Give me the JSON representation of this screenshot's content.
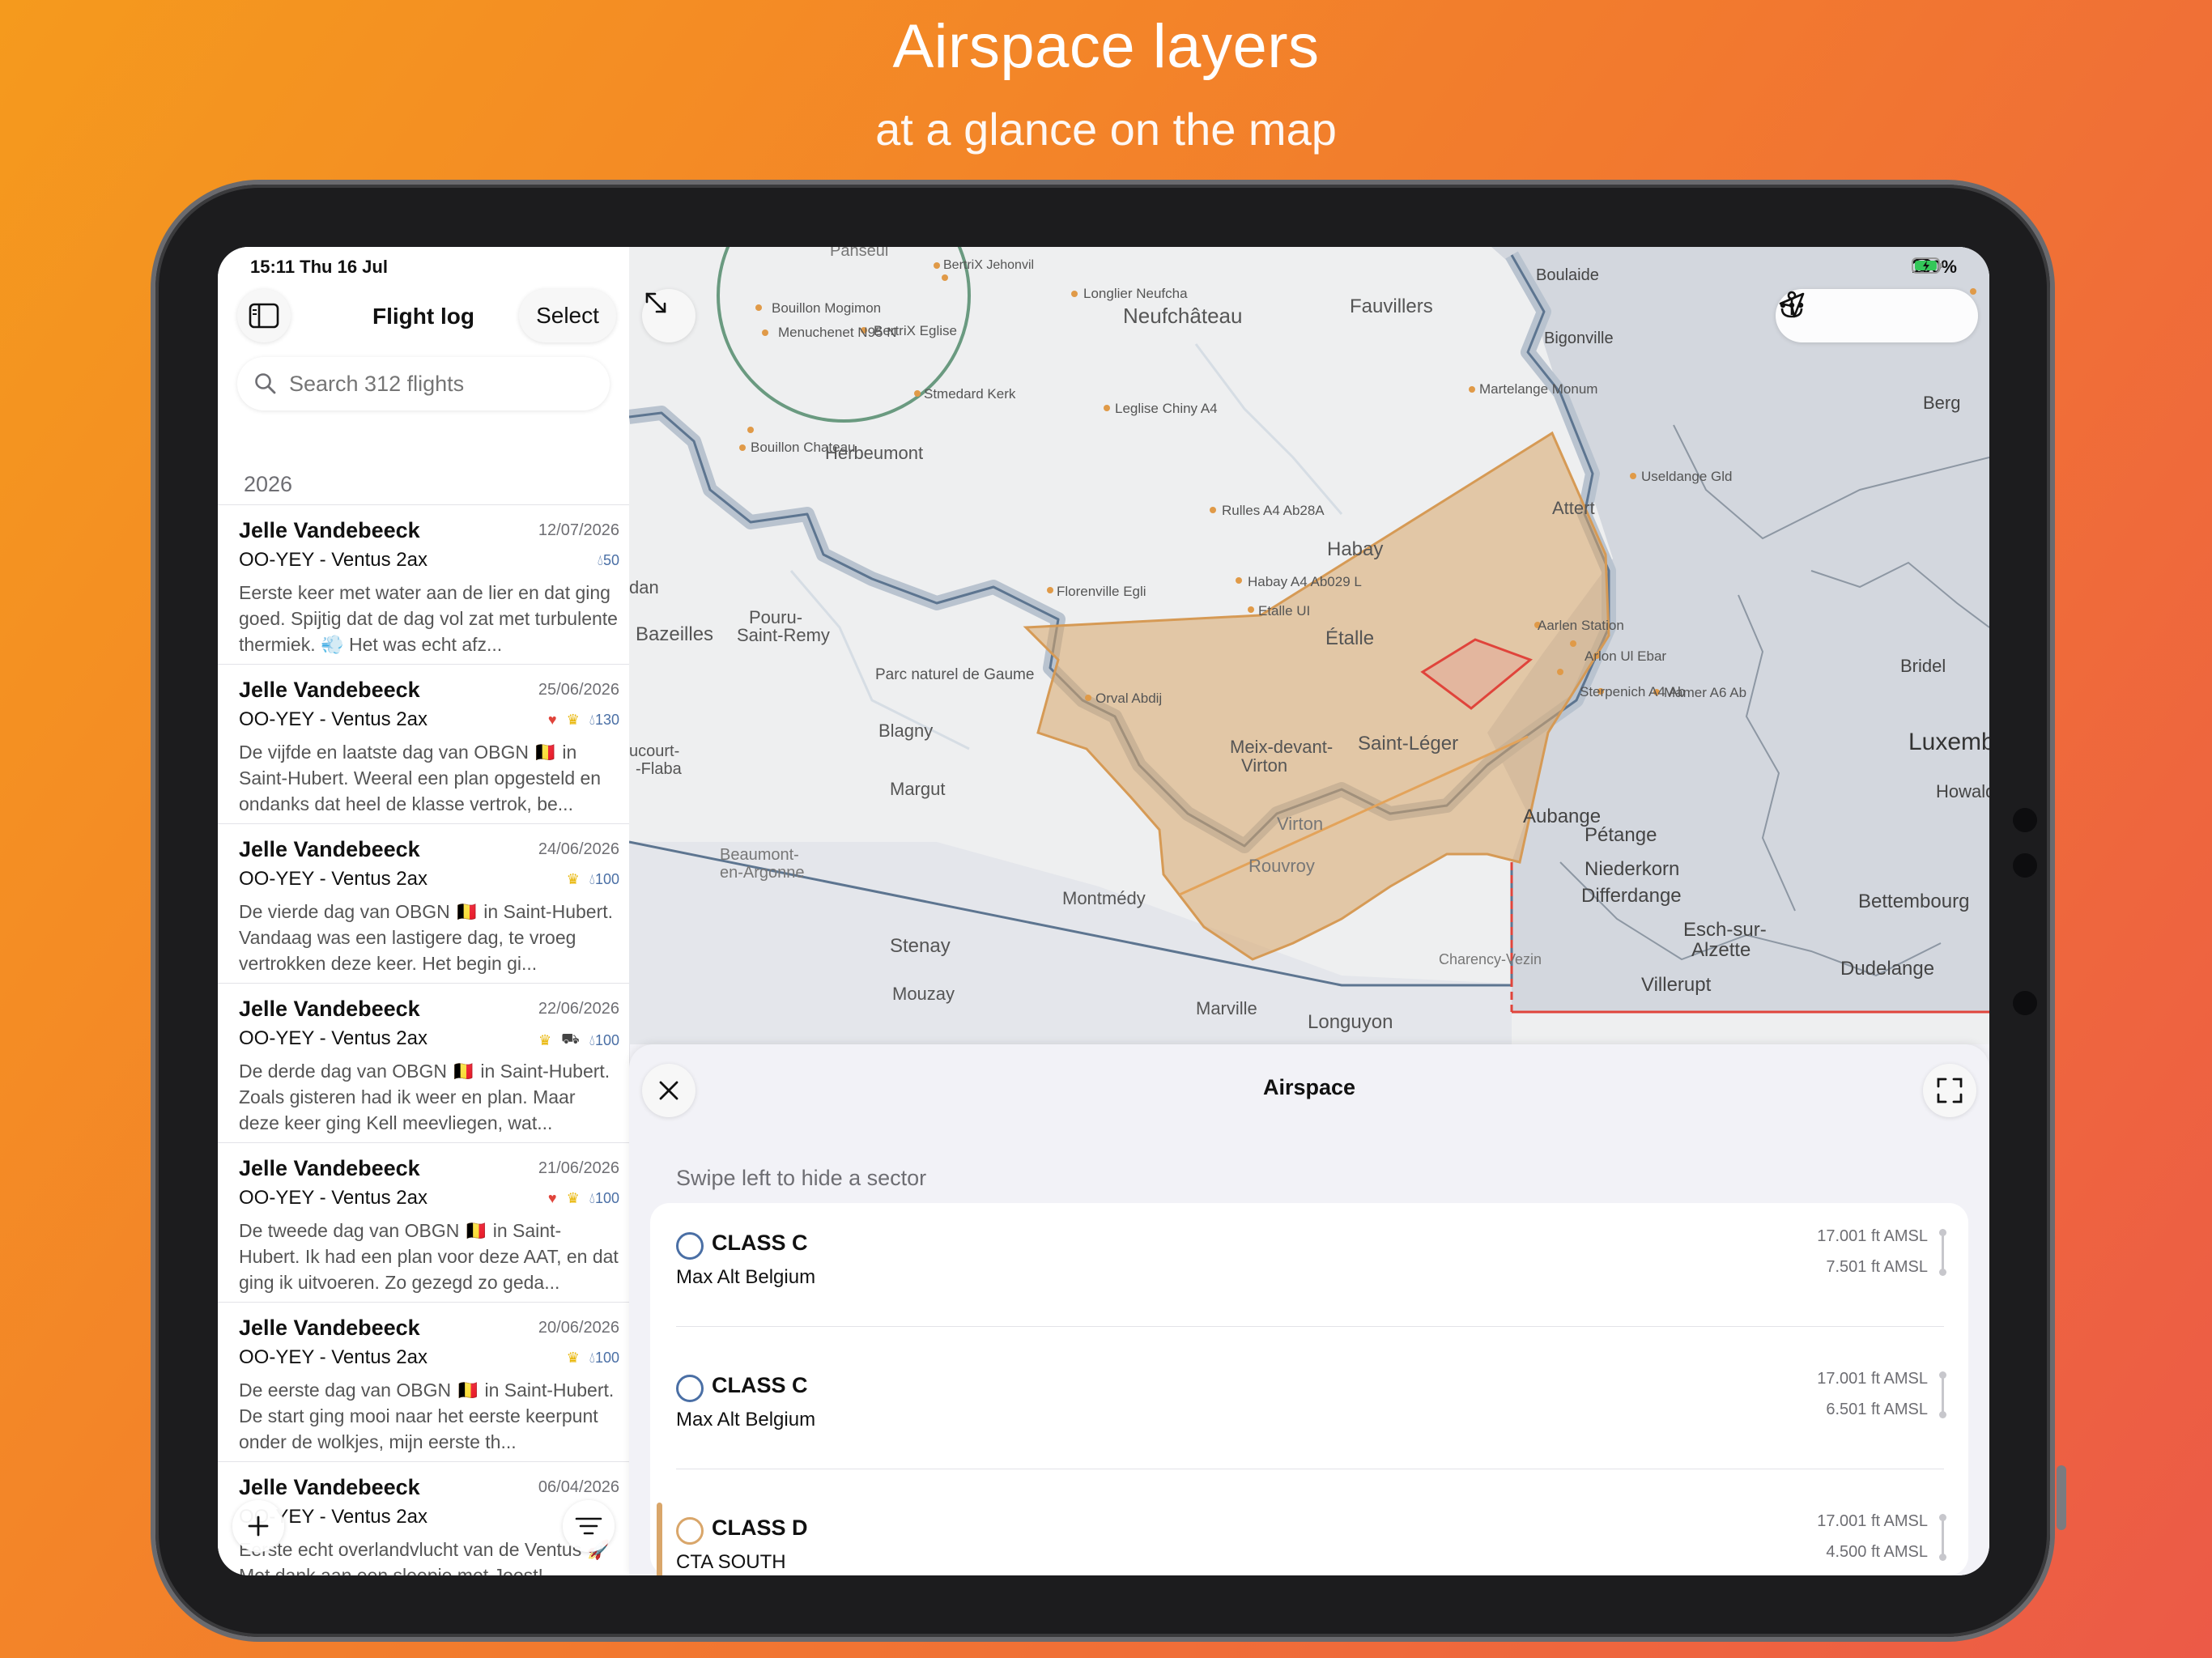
{
  "hero": {
    "title": "Airspace layers",
    "subtitle": "at a glance on the map"
  },
  "status": {
    "time_date": "15:11  Thu 16 Jul",
    "battery": "100%"
  },
  "sidebar": {
    "title": "Flight log",
    "select_label": "Select",
    "search_placeholder": "Search 312 flights",
    "year": "2026",
    "entries": [
      {
        "name": "Jelle Vandebeeck",
        "date": "12/07/2026",
        "plane": "OO-YEY - Ventus 2ax",
        "water": "50",
        "heart": false,
        "crown": false,
        "car": false,
        "preview": "Eerste keer met water aan de lier en dat ging goed. Spijtig dat de dag vol zat met turbulente thermiek. 💨 Het was echt afz..."
      },
      {
        "name": "Jelle Vandebeeck",
        "date": "25/06/2026",
        "plane": "OO-YEY - Ventus 2ax",
        "water": "130",
        "heart": true,
        "crown": true,
        "car": false,
        "preview": "De vijfde en laatste dag van OBGN 🇧🇪 in Saint-Hubert. Weeral een plan opgesteld en ondanks dat heel de klasse vertrok, be..."
      },
      {
        "name": "Jelle Vandebeeck",
        "date": "24/06/2026",
        "plane": "OO-YEY - Ventus 2ax",
        "water": "100",
        "heart": false,
        "crown": true,
        "car": false,
        "preview": "De vierde dag van OBGN 🇧🇪 in Saint-Hubert. Vandaag was een lastigere dag, te vroeg vertrokken deze keer. Het begin gi..."
      },
      {
        "name": "Jelle Vandebeeck",
        "date": "22/06/2026",
        "plane": "OO-YEY - Ventus 2ax",
        "water": "100",
        "heart": false,
        "crown": true,
        "car": true,
        "preview": "De derde dag van OBGN 🇧🇪 in Saint-Hubert. Zoals gisteren had ik weer en plan. Maar deze keer ging Kell meevliegen, wat..."
      },
      {
        "name": "Jelle Vandebeeck",
        "date": "21/06/2026",
        "plane": "OO-YEY - Ventus 2ax",
        "water": "100",
        "heart": true,
        "crown": true,
        "car": false,
        "preview": "De tweede dag van OBGN 🇧🇪 in Saint-Hubert. Ik had een plan voor deze AAT, en dat ging ik uitvoeren. Zo gezegd zo geda..."
      },
      {
        "name": "Jelle Vandebeeck",
        "date": "20/06/2026",
        "plane": "OO-YEY - Ventus 2ax",
        "water": "100",
        "heart": false,
        "crown": true,
        "car": false,
        "preview": "De eerste dag van OBGN 🇧🇪 in Saint-Hubert. De start ging mooi naar het eerste keerpunt onder de wolkjes, mijn eerste th..."
      },
      {
        "name": "Jelle Vandebeeck",
        "date": "06/04/2026",
        "plane": "OO-YEY - Ventus 2ax",
        "water": "",
        "heart": false,
        "crown": false,
        "car": false,
        "preview": "Eerste echt overlandvlucht van de Ventus 🚀 Met dank aan een sleepje met Joost!"
      }
    ]
  },
  "map": {
    "labels": {
      "neufchateau": "Neufchâteau",
      "fauvillers": "Fauvillers",
      "herbeumont": "Herbeumont",
      "habay": "Habay",
      "etalle": "Étalle",
      "attert": "Attert",
      "saint_leger": "Saint-Léger",
      "meix": "Meix-devant-",
      "virton_sub": "Virton",
      "virton": "Virton",
      "rouvroy": "Rouvroy",
      "blagny": "Blagny",
      "margut": "Margut",
      "montmedy": "Montmédy",
      "stenay": "Stenay",
      "mouzay": "Mouzay",
      "marville": "Marville",
      "longuyon": "Longuyon",
      "bazeilles": "Bazeilles",
      "pouru1": "Pouru-",
      "pouru2": "Saint-Remy",
      "ucourt1": "ucourt-",
      "ucourt2": "-Flaba",
      "dan": "dan",
      "aubange": "Aubange",
      "petange": "Pétange",
      "niederkorn": "Niederkorn",
      "differdange": "Differdange",
      "esch1": "Esch-sur-",
      "esch2": "Alzette",
      "dudelange": "Dudelange",
      "villerupt": "Villerupt",
      "bettembourg": "Bettembourg",
      "luxembourg": "Luxembourg",
      "howald": "Howald",
      "berg": "Berg",
      "bridel": "Bridel",
      "boulaide": "Boulaide",
      "bigonville": "Bigonville",
      "parc": "Parc naturel de Gaume",
      "beaumont1": "Beaumont-",
      "beaumont2": "en-Argonne",
      "charency": "Charency-Vezin",
      "pahseul": "Pahseul",
      "wp_bertrix_jehonvil": "BertriX Jehonvil",
      "wp_bouillon_mogimon": "Bouillon Mogimon",
      "wp_menuchenet": "Menuchenet N95 N",
      "wp_bertrix_eglise": "BertriX Eglise",
      "wp_longlier": "Longlier Neufcha",
      "wp_stmedard": "Stmedard Kerk",
      "wp_leglise": "Leglise Chiny A4",
      "wp_martelange": "Martelange Monum",
      "wp_bouillon_chateau": "Bouillon Chateau",
      "wp_rulles": "Rulles A4 Ab28A",
      "wp_habay": "Habay A4 Ab029 L",
      "wp_etalle": "Etalle UI",
      "wp_florenville": "Florenville Egli",
      "wp_orval": "Orval Abdij",
      "wp_arlon_station": "Aarlen Station",
      "wp_arlon_ebar": "Arlon Ul Ebar",
      "wp_sterpenich": "Sterpenich A4 Ab",
      "wp_mamer": "Mamer A6 Ab",
      "wp_useldange": "Useldange Gld"
    }
  },
  "sheet": {
    "title": "Airspace",
    "hint": "Swipe left to hide a sector",
    "rows": [
      {
        "cls": "CLASS C",
        "name": "Max Alt Belgium",
        "upper": "17.001 ft AMSL",
        "lower": "7.501 ft AMSL",
        "color": "#4a6fa5"
      },
      {
        "cls": "CLASS C",
        "name": "Max Alt Belgium",
        "upper": "17.001 ft AMSL",
        "lower": "6.501 ft AMSL",
        "color": "#4a6fa5"
      },
      {
        "cls": "CLASS D",
        "name": "CTA SOUTH",
        "upper": "17.001 ft AMSL",
        "lower": "4.500 ft AMSL",
        "color": "#d9a66a"
      }
    ]
  },
  "colors": {
    "accent_orange": "#f27a2e",
    "airspace_d": "#d9a66a",
    "airspace_c": "#4a6fa5",
    "danger": "#e0443b"
  }
}
